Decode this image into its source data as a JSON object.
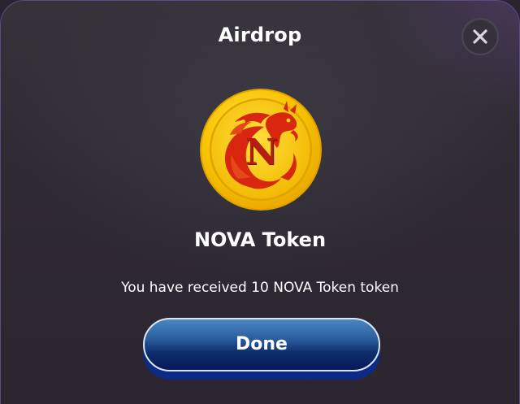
{
  "dialog": {
    "title": "Airdrop",
    "token_name": "NOVA Token",
    "message": "You have received 10 NOVA Token token",
    "done_label": "Done",
    "close_icon": "close-icon",
    "token_logo_icon": "nova-dragon-coin-icon"
  },
  "colors": {
    "dialog_background": "#2e2a33",
    "dialog_border": "#5d4a86",
    "coin_gold": "#f7c400",
    "coin_emblem_red": "#d8260f",
    "done_button_top": "#4a86c2",
    "done_button_bottom": "#07195a",
    "text": "#ffffff"
  }
}
